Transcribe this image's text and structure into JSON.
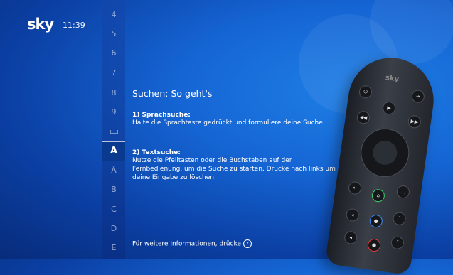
{
  "header": {
    "logo": "sky",
    "time": "11:39"
  },
  "letter_strip": {
    "items": [
      "4",
      "5",
      "6",
      "7",
      "8",
      "9",
      "",
      "A",
      "Ä",
      "B",
      "C",
      "D",
      "E"
    ],
    "selected": "A"
  },
  "help": {
    "title": "Suchen: So geht's",
    "voice_heading": "1) Sprachsuche:",
    "voice_body": "Halte die Sprachtaste gedrückt und formuliere deine Suche.",
    "text_heading": "2) Textsuche:",
    "text_body": "Nutze die Pfeiltasten oder die Buchstaben auf der Fernbedienung, um die Suche zu starten. Drücke nach links um deine Eingabe zu löschen.",
    "footer": "Für weitere Informationen, drücke",
    "footer_icon": "?"
  },
  "remote": {
    "logo": "sky"
  }
}
